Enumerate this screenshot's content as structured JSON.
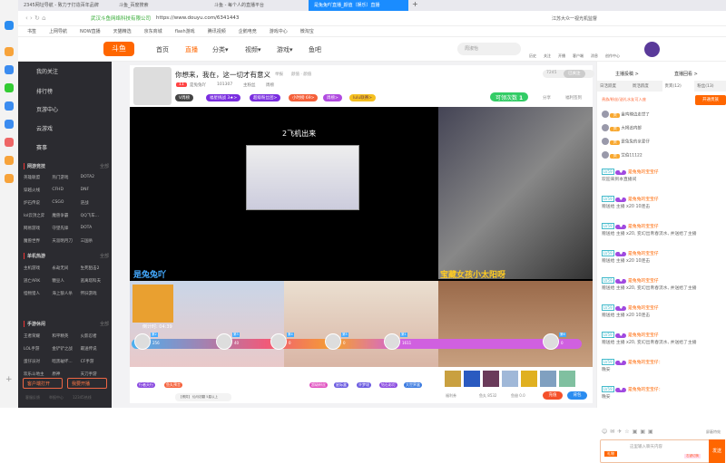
{
  "browser": {
    "tabs": [
      "2345网址导航 - 致力于打造百年品牌",
      "斗鱼_百度搜索",
      "斗鱼 - 每个人的直播平台",
      "是兔兔吖直播_颜值（娱乐）直播"
    ],
    "cert": "武汉斗鱼网络科技有限公司",
    "url": "https://www.douyu.com/6341443",
    "search_hint": "江苏大众一视光机监督",
    "bookmarks": [
      "书签",
      "上网导航",
      "NOW直播",
      "天猫精选",
      "京东商城",
      "flash游戏",
      "腾讯视频",
      "企鹅电竞",
      "游戏中心",
      "微淘宝"
    ]
  },
  "header": {
    "nav": [
      "首页",
      "直播",
      "分类▾",
      "视频▾",
      "游戏▾",
      "鱼吧"
    ],
    "search_placeholder": "周淑怡",
    "icons": [
      "历史",
      "关注",
      "开播",
      "客户端",
      "消息",
      "创作中心"
    ]
  },
  "sidebar": {
    "items": [
      "我的关注",
      "排行榜",
      "页游中心",
      "云游戏",
      "赛事"
    ],
    "sections": [
      {
        "title": "网游竞技",
        "more": "全部",
        "items": [
          "英雄联盟",
          "热门游戏",
          "DOTA2",
          "穿越火线",
          "CFHD",
          "DNF",
          "炉石传说",
          "CSGO",
          "逆战",
          "lol云顶之弈",
          "魔兽争霸",
          "QQ飞车...",
          "网易游戏",
          "守望先锋",
          "DOTA",
          "魔兽世界",
          "天涯明月刀",
          "三国杀"
        ]
      },
      {
        "title": "单机热游",
        "more": "全部",
        "items": [
          "主机游戏",
          "永劫无间",
          "生死狙击2",
          "逃亡ARK",
          "糖豆人",
          "逃离塔科夫",
          "怪物猎人",
          "海上狼人杀",
          "怀旧游戏"
        ]
      },
      {
        "title": "手游休闲",
        "more": "全部",
        "items": [
          "王者荣耀",
          "和平精英",
          "火影忍者",
          "LOL手游",
          "金铲铲之战",
          "最送传说",
          "蛋仔派对",
          "暗黑破坏...",
          "CF手游",
          "欢乐斗地主",
          "原神",
          "天刀手游"
        ]
      }
    ],
    "client_btn": "客户端打开",
    "live_btn": "我要开播",
    "footer": [
      "客服反馈",
      "举报中心",
      "12345热线"
    ]
  },
  "room": {
    "title": "你想来，我在，这一切才有意义",
    "tag1": "举报",
    "tag2": "颜值 · 颜值",
    "level": "11",
    "name": "是兔兔吖",
    "heat": "101307",
    "fans": "主粉丝",
    "rank": "周榜",
    "follow_count": "7245",
    "follow_btn": "已关注",
    "badges": [
      "V周榜",
      "福星挑战 3★>",
      "超级粉丝团>",
      "小时榜 69>",
      "周榜>",
      "lulu联赛>"
    ],
    "reward": "可领次数",
    "reward_n": "1",
    "share": "分享",
    "gift_center": "福利签到",
    "overlay": "2飞机出来",
    "streamer_left": "是兔兔吖",
    "streamer_right": "宝藏女孩小太阳呀",
    "timer": "倒计时: 04:39",
    "pk": [
      {
        "rank": "第2",
        "val": "256"
      },
      {
        "rank": "第3",
        "val": "40"
      },
      {
        "rank": "第4",
        "val": "0"
      },
      {
        "rank": "第5",
        "val": "0"
      },
      {
        "rank": "第1",
        "val": "1611"
      },
      {
        "rank": "第6",
        "val": "0"
      }
    ]
  },
  "gifts": {
    "left": [
      "行者天行",
      "鱼丸预言"
    ],
    "mid": [
      "超级粉丝",
      "星际盒",
      "许梦境",
      "钻石彩灯",
      "大世界盒"
    ],
    "notice": "【博弈】 仙马初翻 5星以上",
    "wallet": "福利券",
    "fish": "鱼丸 8532",
    "coins": "鱼翅 0.0",
    "recharge": "充值",
    "bag": "背包"
  },
  "chat": {
    "tabs_top": [
      "主播投稿 >",
      "直播回看 >"
    ],
    "tabs": [
      "日活跃度",
      "周活跃度",
      "贵宾(12)",
      "粉丝(13)"
    ],
    "vip_hint": "贵族/粉丝/送礼水友可入座",
    "open_btn": "开通贵族",
    "vips": [
      "金鸡辣边走世了",
      "大揭追内部",
      "是兔兔的亲爱仔",
      "艾伯11122"
    ],
    "messages": [
      {
        "lv": "LV59",
        "user": "是兔兔的宝宝仔",
        "text": "欢迎来到本直播间"
      },
      {
        "lv": "LV59",
        "user": "是兔兔的宝宝仔",
        "text": "赠送给 主播 x20 10连击"
      },
      {
        "lv": "LV59",
        "user": "是兔兔的宝宝仔",
        "text": "赠送给 主播 x20, 变幻出青春流水, 并送给了主播"
      },
      {
        "lv": "LV59",
        "user": "是兔兔的宝宝仔",
        "text": "赠送给 主播 x20 10连击"
      },
      {
        "lv": "LV59",
        "user": "是兔兔的宝宝仔",
        "text": "赠送给 主播 x20, 变幻出青春流水, 并送给了主播"
      },
      {
        "lv": "LV59",
        "user": "是兔兔的宝宝仔",
        "text": "赠送给 主播 x20 10连击"
      },
      {
        "lv": "LV59",
        "user": "是兔兔的宝宝仔",
        "text": "赠送给 主播 x20, 变幻出青春流水, 并送给了主播"
      },
      {
        "lv": "LV59",
        "user": "是兔兔的宝宝仔：",
        "text": "晚安"
      },
      {
        "lv": "LV59",
        "user": "是兔兔的宝宝仔：",
        "text": "晚安"
      }
    ],
    "block": "屏蔽特效",
    "input_placeholder": "这里输入聊天内容",
    "gift": "礼物",
    "send": "发送",
    "send_hint": "右键切换"
  }
}
